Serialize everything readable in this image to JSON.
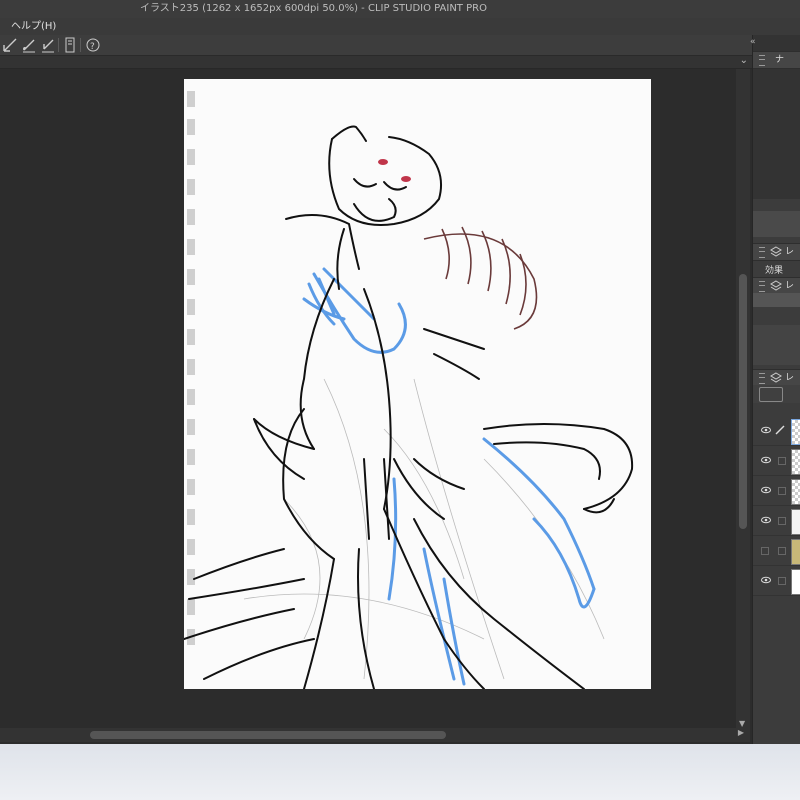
{
  "window": {
    "title": "イラスト235 (1262 x 1652px 600dpi 50.0%)  - CLIP STUDIO PAINT PRO"
  },
  "menubar": {
    "help": "ヘルプ(H)"
  },
  "toolbar": {
    "icons": [
      "pen-ruler-icon",
      "brush-icon",
      "pencil-line-icon",
      "panel-icon",
      "help-bubble-icon"
    ]
  },
  "right_panel": {
    "tab1_label": "ナ",
    "row_layer_label": "レ",
    "effect_label": "効果",
    "row_layer2_label": "レ",
    "row_layer3_label": "レ",
    "layers": [
      {
        "visible": true,
        "type": "raster-active"
      },
      {
        "visible": true,
        "type": "raster"
      },
      {
        "visible": true,
        "type": "raster"
      },
      {
        "visible": true,
        "type": "raster"
      },
      {
        "visible": false,
        "type": "paper-tan"
      },
      {
        "visible": true,
        "type": "paper-white"
      }
    ]
  },
  "colors": {
    "lineart": "#111111",
    "sketch_blue": "#5b9be6",
    "sketch_brown": "#6a3a3a",
    "accent_red": "#c0354a"
  }
}
